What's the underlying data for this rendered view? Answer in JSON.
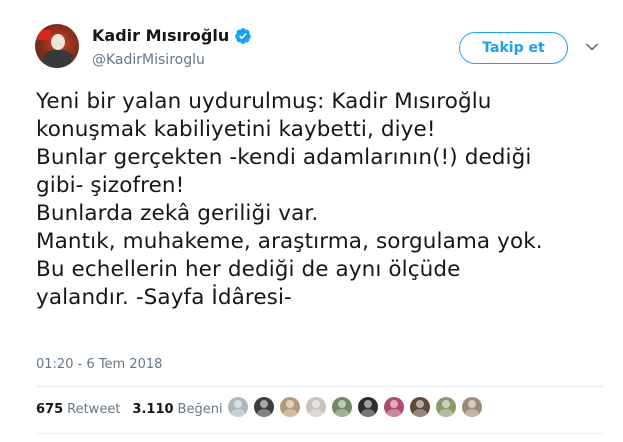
{
  "profile": {
    "name": "Kadir Mısıroğlu",
    "handle": "@KadirMisiroglu",
    "avatar_icon": "profile-photo-icon",
    "verified_icon": "verified-badge-icon",
    "verified_color": "#1da1f2"
  },
  "actions": {
    "follow_label": "Takip et",
    "menu_icon": "chevron-down-icon",
    "accent_color": "#1da1f2"
  },
  "tweet": {
    "lines": [
      "Yeni bir yalan uydurulmuş: Kadir Mısıroğlu",
      "konuşmak kabiliyetini kaybetti, diye!",
      "Bunlar gerçekten -kendi adamlarının(!) dediği",
      "gibi- şizofren!",
      "Bunlarda zekâ geriliği var.",
      "Mantık, muhakeme, araştırma, sorgulama yok.",
      "Bu echellerin her dediği de aynı ölçüde",
      "yalandır. -Sayfa İdâresi-"
    ],
    "timestamp": "01:20 - 6 Tem 2018"
  },
  "stats": {
    "retweets_count": "675",
    "retweets_label": "Retweet",
    "likes_count": "3.110",
    "likes_label": "Beğeni"
  },
  "likers": [
    {
      "icon": "avatar-placeholder-icon",
      "color": "#aab8c2"
    },
    {
      "icon": "avatar-icon",
      "color": "#3d3d3d"
    },
    {
      "icon": "avatar-icon",
      "color": "#b59a7a"
    },
    {
      "icon": "avatar-icon",
      "color": "#c8c2b8"
    },
    {
      "icon": "avatar-icon",
      "color": "#6f8a5c"
    },
    {
      "icon": "avatar-icon",
      "color": "#2c2c2c"
    },
    {
      "icon": "avatar-icon",
      "color": "#b04a6e"
    },
    {
      "icon": "avatar-icon",
      "color": "#5c4a38"
    },
    {
      "icon": "avatar-icon",
      "color": "#8a9a6a"
    },
    {
      "icon": "avatar-icon",
      "color": "#9a8a78"
    }
  ]
}
